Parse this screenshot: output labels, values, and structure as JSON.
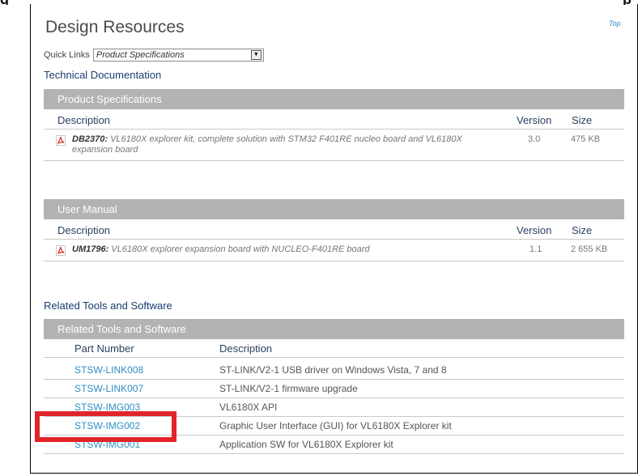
{
  "page": {
    "title": "Design Resources",
    "top_link": "Top"
  },
  "quick_links": {
    "label": "Quick Links",
    "selected": "Product Specifications"
  },
  "technical_documentation": {
    "label": "Technical Documentation"
  },
  "product_specifications": {
    "bar_label": "Product Specifications",
    "columns": {
      "description": "Description",
      "version": "Version",
      "size": "Size"
    },
    "rows": [
      {
        "code": "DB2370:",
        "text": " VL6180X explorer kit, complete solution with STM32 F401RE nucleo board and VL6180X expansion board",
        "version": "3.0",
        "size": "475 KB"
      }
    ]
  },
  "user_manual": {
    "bar_label": "User Manual",
    "columns": {
      "description": "Description",
      "version": "Version",
      "size": "Size"
    },
    "rows": [
      {
        "code": "UM1796:",
        "text": " VL6180X explorer expansion board with NUCLEO-F401RE board",
        "version": "1.1",
        "size": "2 655 KB"
      }
    ]
  },
  "related_tools": {
    "section_label": "Related Tools and Software",
    "bar_label": "Related Tools and Software",
    "columns": {
      "part_number": "Part Number",
      "description": "Description"
    },
    "rows": [
      {
        "part": "STSW-LINK008",
        "description": "ST-LINK/V2-1 USB driver on Windows Vista, 7 and 8"
      },
      {
        "part": "STSW-LINK007",
        "description": "ST-LINK/V2-1 firmware upgrade"
      },
      {
        "part": "STSW-IMG003",
        "description": "VL6180X API"
      },
      {
        "part": "STSW-IMG002",
        "description": "Graphic User Interface (GUI) for VL6180X Explorer kit"
      },
      {
        "part": "STSW-IMG001",
        "description": "Application SW for VL6180X Explorer kit"
      }
    ]
  },
  "colors": {
    "link": "#2f8fc2",
    "bar": "#b3b3b3",
    "highlight": "#e2242b"
  }
}
